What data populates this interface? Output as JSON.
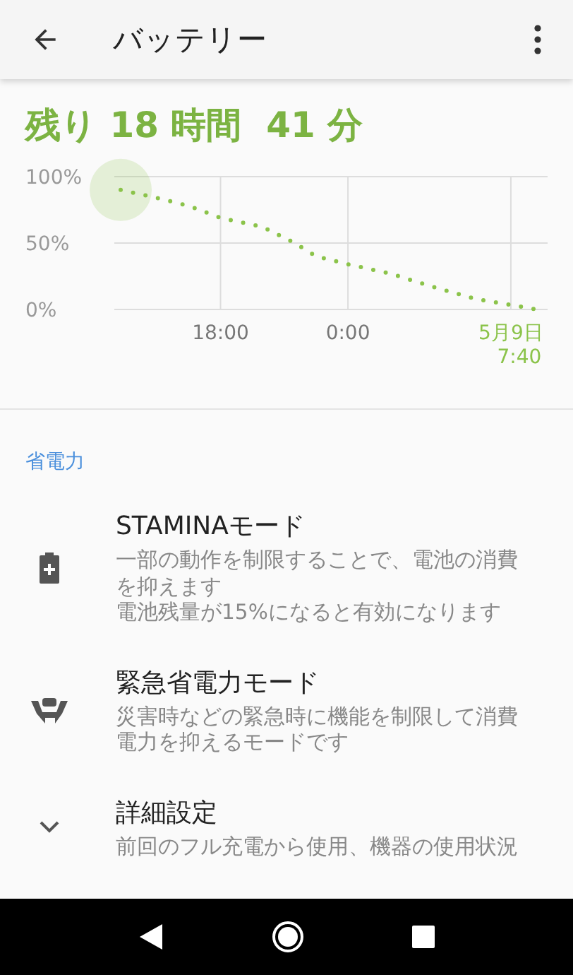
{
  "app_bar": {
    "title": "バッテリー"
  },
  "summary": "残り 18 時間  41 分",
  "chart": {
    "chart_data": {
      "type": "line",
      "x": [
        13.3,
        15,
        16.5,
        18,
        20,
        21.5,
        22.5,
        24,
        26,
        28,
        30,
        32.9
      ],
      "series": [
        {
          "color": "#8bc34a",
          "line_style": "dotted",
          "values": [
            90,
            84,
            78,
            69,
            62,
            50,
            40,
            34,
            27,
            17,
            8,
            0
          ]
        }
      ],
      "grid": true,
      "xlim": [
        13,
        33.4
      ],
      "ylim": [
        0,
        100
      ],
      "xticks": [
        {
          "value": 18,
          "label": "18:00"
        },
        {
          "value": 24,
          "label": "0:00"
        },
        {
          "value": 31.67,
          "label": "5月9日 7:40"
        }
      ],
      "yticks": [
        {
          "value": 0,
          "label": "0%"
        },
        {
          "value": 50,
          "label": "50%"
        },
        {
          "value": 100,
          "label": "100%"
        }
      ]
    }
  },
  "section": {
    "title": "省電力",
    "items": [
      {
        "kind": "battery",
        "title": "STAMINAモード",
        "description": [
          "一部の動作を制限することで、電池の消費を抑えます",
          "電池残量が15%になると有効になります"
        ]
      },
      {
        "kind": "emergency",
        "title": "緊急省電力モード",
        "description": [
          "災害時などの緊急時に機能を制限して消費電力を抑えるモードです"
        ]
      },
      {
        "kind": "expand",
        "title": "詳細設定",
        "description": [
          "前回のフル充電から使用、機器の使用状況"
        ]
      }
    ]
  }
}
